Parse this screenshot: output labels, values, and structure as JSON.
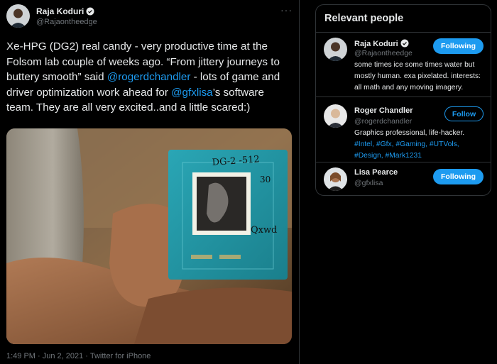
{
  "tweet": {
    "author_name": "Raja Koduri",
    "author_handle": "@Rajaontheedge",
    "more_label": "···",
    "text_parts": {
      "p1": "Xe-HPG (DG2) real candy - very productive time at the Folsom lab couple of weeks ago. “From jittery journeys to buttery smooth” said ",
      "m1": "@rogerdchandler",
      "p2": " - lots of game and driver optimization work ahead for ",
      "m2": "@gfxlisa",
      "p3": "’s software team. They are all very excited..and a little scared:)"
    },
    "photo_chip_text": "DG-2 - 512\n30\nQxwd",
    "time": "1:49 PM",
    "date": "Jun 2, 2021",
    "source": "Twitter for iPhone",
    "sep": " · "
  },
  "people": {
    "title": "Relevant people",
    "items": [
      {
        "name": "Raja Koduri",
        "handle": "@Rajaontheedge",
        "bio": "some times ice some times water but mostly human. exa pixelated. interests: all math and any moving imagery.",
        "button": "Following",
        "verified": true
      },
      {
        "name": "Roger Chandler",
        "handle": "@rogerdchandler",
        "bio_text": "Graphics professional, life-hacker.",
        "bio_tags": "#Intel, #Gfx, #Gaming, #UTVols, #Design, #Mark1231",
        "button": "Follow",
        "verified": false
      },
      {
        "name": "Lisa Pearce",
        "handle": "@gfxlisa",
        "button": "Following",
        "verified": false
      }
    ]
  },
  "colors": {
    "accent": "#1d9bf0",
    "background": "#000000",
    "border": "#2f3336",
    "muted": "#71767b"
  }
}
